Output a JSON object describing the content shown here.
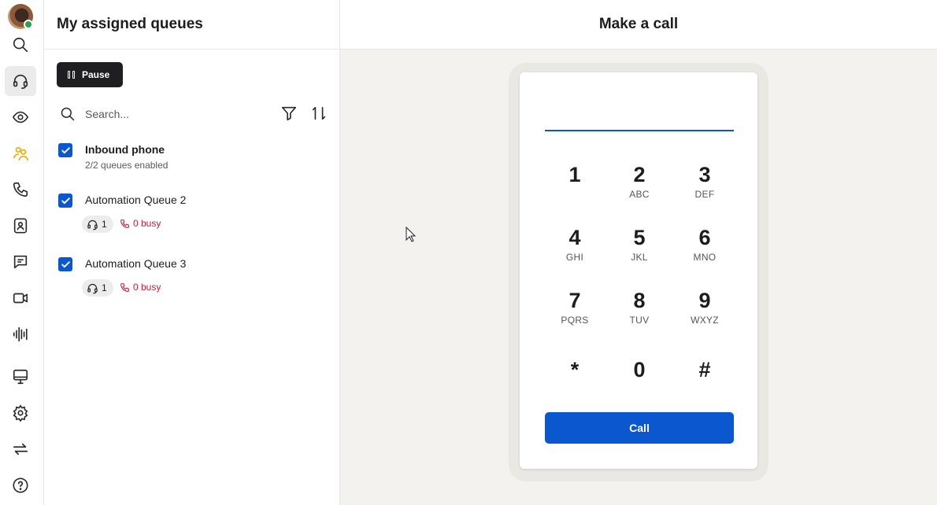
{
  "rail": {
    "icons": [
      "search-icon",
      "headset-icon",
      "eye-icon",
      "users-icon",
      "phone-icon",
      "contacts-icon",
      "chat-icon",
      "video-icon",
      "waveform-icon",
      "monitor-icon",
      "gear-icon",
      "transfer-icon",
      "help-icon"
    ],
    "accent_color": "#f2a900"
  },
  "queues": {
    "title": "My assigned queues",
    "pause_label": "Pause",
    "search_placeholder": "Search...",
    "group": {
      "name": "Inbound phone",
      "subtitle": "2/2 queues enabled"
    },
    "items": [
      {
        "name": "Automation Queue 2",
        "agents": "1",
        "busy": "0 busy"
      },
      {
        "name": "Automation Queue 3",
        "agents": "1",
        "busy": "0 busy"
      }
    ]
  },
  "dialer": {
    "title": "Make a call",
    "keys": [
      {
        "num": "1",
        "sub": ""
      },
      {
        "num": "2",
        "sub": "ABC"
      },
      {
        "num": "3",
        "sub": "DEF"
      },
      {
        "num": "4",
        "sub": "GHI"
      },
      {
        "num": "5",
        "sub": "JKL"
      },
      {
        "num": "6",
        "sub": "MNO"
      },
      {
        "num": "7",
        "sub": "PQRS"
      },
      {
        "num": "8",
        "sub": "TUV"
      },
      {
        "num": "9",
        "sub": "WXYZ"
      },
      {
        "num": "*",
        "sub": ""
      },
      {
        "num": "0",
        "sub": ""
      },
      {
        "num": "#",
        "sub": ""
      }
    ],
    "call_label": "Call",
    "primary_color": "#0b57d0"
  }
}
